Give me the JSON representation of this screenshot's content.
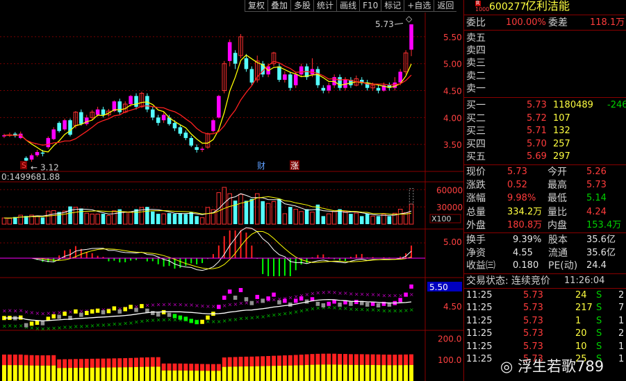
{
  "toolbar": [
    "复权",
    "叠加",
    "多股",
    "统计",
    "画线",
    "F10",
    "标记",
    "+自选",
    "返回"
  ],
  "stock": {
    "badge_top": "R",
    "badge_bottom": "1000",
    "code": "600277",
    "name": "亿利洁能"
  },
  "order_ratio": {
    "label": "委比",
    "value": "100.00%",
    "diff_label": "委差",
    "diff_value": "118.1万"
  },
  "sell_levels": [
    "卖五",
    "卖四",
    "卖三",
    "卖二",
    "卖一"
  ],
  "buy_levels": [
    {
      "label": "买一",
      "price": "5.73",
      "volume": "1180489",
      "change": "-246"
    },
    {
      "label": "买二",
      "price": "5.72",
      "volume": "107",
      "change": ""
    },
    {
      "label": "买三",
      "price": "5.71",
      "volume": "132",
      "change": ""
    },
    {
      "label": "买四",
      "price": "5.70",
      "volume": "257",
      "change": ""
    },
    {
      "label": "买五",
      "price": "5.69",
      "volume": "297",
      "change": ""
    }
  ],
  "quote": [
    {
      "l1": "现价",
      "v1": "5.73",
      "l2": "今开",
      "v2": "5.26"
    },
    {
      "l1": "涨跌",
      "v1": "0.52",
      "l2": "最高",
      "v2": "5.73"
    },
    {
      "l1": "涨幅",
      "v1": "9.98%",
      "l2": "最低",
      "v2": "5.14"
    },
    {
      "l1": "总量",
      "v1": "334.2万",
      "l2": "量比",
      "v2": "4.24"
    },
    {
      "l1": "外盘",
      "v1": "180.8万",
      "l2": "内盘",
      "v2": "153.4万"
    }
  ],
  "finance": [
    {
      "l1": "换手",
      "v1": "9.39%",
      "l2": "股本",
      "v2": "35.6亿"
    },
    {
      "l1": "净资",
      "v1": "4.55",
      "l2": "流通",
      "v2": "35.6亿"
    },
    {
      "l1": "收益㈢",
      "v1": "0.180",
      "l2": "PE(动)",
      "v2": "24.4"
    }
  ],
  "trade_status": {
    "label": "交易状态:",
    "value": "连续竞价",
    "time": "11:26:04"
  },
  "ticks": [
    {
      "time": "11:25",
      "price": "5.73",
      "vol": "24",
      "side": "S",
      "n": "2"
    },
    {
      "time": "11:25",
      "price": "5.73",
      "vol": "217",
      "side": "S",
      "n": "7"
    },
    {
      "time": "11:25",
      "price": "5.73",
      "vol": "1",
      "side": "S",
      "n": "1"
    },
    {
      "time": "11:25",
      "price": "5.73",
      "vol": "20",
      "side": "S",
      "n": "2"
    },
    {
      "time": "11:25",
      "price": "5.73",
      "vol": "10",
      "side": "S",
      "n": "1"
    },
    {
      "time": "11:25",
      "price": "5.73",
      "vol": "25",
      "side": "S",
      "n": "1"
    }
  ],
  "chart_data": {
    "type": "candlestick",
    "price_axis_ticks": [
      "5.50",
      "5.00",
      "4.50",
      "4.00",
      "3.50"
    ],
    "ylim": [
      3.0,
      5.95
    ],
    "annotations": {
      "high": "5.73",
      "low": "3.12",
      "marker_s": "S",
      "marker_cai": "财",
      "marker_zhang": "涨"
    },
    "volume_label": "0:1499681.88",
    "volume_ticks": [
      "60000",
      "30000"
    ],
    "volume_unit": "X100",
    "macd_tick": "5.00",
    "indicator_ticks": [
      "5.50",
      "4.50"
    ],
    "bottom_ticks": [
      "200.0",
      "100.0"
    ],
    "candles": [
      [
        3.65,
        3.67,
        3.7,
        3.62
      ],
      [
        3.67,
        3.68,
        3.72,
        3.64
      ],
      [
        3.7,
        3.66,
        3.73,
        3.63
      ],
      [
        3.62,
        3.7,
        3.74,
        3.6
      ],
      [
        3.25,
        3.2,
        3.28,
        3.12
      ],
      [
        3.22,
        3.3,
        3.33,
        3.18
      ],
      [
        3.3,
        3.36,
        3.4,
        3.27
      ],
      [
        3.35,
        3.33,
        3.4,
        3.28
      ],
      [
        3.45,
        3.62,
        3.65,
        3.42
      ],
      [
        3.6,
        3.78,
        3.82,
        3.58
      ],
      [
        3.9,
        3.75,
        3.93,
        3.72
      ],
      [
        3.78,
        3.95,
        3.98,
        3.75
      ],
      [
        3.95,
        3.68,
        3.98,
        3.65
      ],
      [
        3.85,
        4.1,
        4.12,
        3.8
      ],
      [
        4.1,
        3.88,
        4.15,
        3.85
      ],
      [
        3.88,
        4.0,
        4.05,
        3.85
      ],
      [
        4.0,
        4.1,
        4.14,
        3.96
      ],
      [
        4.05,
        4.15,
        4.2,
        4.02
      ],
      [
        4.15,
        4.05,
        4.2,
        4.0
      ],
      [
        4.05,
        4.12,
        4.16,
        4.02
      ],
      [
        4.12,
        4.3,
        4.32,
        4.1
      ],
      [
        4.3,
        4.1,
        4.35,
        4.06
      ],
      [
        4.1,
        4.25,
        4.3,
        4.08
      ],
      [
        4.25,
        4.4,
        4.42,
        4.2
      ],
      [
        4.4,
        4.2,
        4.45,
        4.15
      ],
      [
        4.2,
        4.45,
        4.48,
        4.18
      ],
      [
        4.4,
        4.15,
        4.45,
        4.1
      ],
      [
        4.15,
        4.0,
        4.2,
        3.95
      ],
      [
        4.0,
        3.9,
        4.05,
        3.85
      ],
      [
        3.95,
        4.05,
        4.1,
        3.9
      ],
      [
        4.0,
        3.88,
        4.05,
        3.85
      ],
      [
        3.9,
        3.8,
        3.95,
        3.75
      ],
      [
        3.82,
        3.7,
        3.86,
        3.66
      ],
      [
        3.72,
        3.62,
        3.76,
        3.58
      ],
      [
        3.62,
        3.48,
        3.66,
        3.45
      ],
      [
        3.45,
        3.4,
        3.5,
        3.35
      ],
      [
        3.4,
        3.42,
        3.46,
        3.36
      ],
      [
        3.45,
        3.7,
        3.72,
        3.42
      ],
      [
        3.75,
        3.95,
        3.98,
        3.72
      ],
      [
        4.0,
        4.4,
        4.42,
        3.98
      ],
      [
        4.5,
        5.0,
        5.05,
        4.45
      ],
      [
        5.05,
        5.4,
        5.45,
        4.95
      ],
      [
        5.2,
        5.0,
        5.25,
        4.9
      ],
      [
        5.15,
        5.5,
        5.55,
        5.1
      ],
      [
        5.1,
        4.9,
        5.18,
        4.85
      ],
      [
        4.9,
        4.65,
        4.95,
        4.6
      ],
      [
        4.7,
        5.05,
        5.15,
        4.65
      ],
      [
        5.0,
        4.8,
        5.05,
        4.75
      ],
      [
        4.8,
        4.95,
        5.0,
        4.75
      ],
      [
        5.0,
        5.2,
        5.22,
        4.95
      ],
      [
        4.95,
        4.7,
        5.0,
        4.66
      ],
      [
        4.7,
        4.8,
        4.86,
        4.65
      ],
      [
        4.8,
        4.55,
        4.85,
        4.5
      ],
      [
        4.6,
        4.8,
        4.85,
        4.55
      ],
      [
        4.8,
        4.95,
        5.0,
        4.75
      ],
      [
        4.95,
        4.75,
        5.0,
        4.7
      ],
      [
        4.8,
        4.9,
        5.1,
        4.75
      ],
      [
        4.9,
        4.6,
        4.95,
        4.55
      ],
      [
        4.55,
        4.5,
        4.6,
        4.45
      ],
      [
        4.5,
        4.6,
        4.65,
        4.45
      ],
      [
        4.6,
        4.75,
        4.8,
        4.55
      ],
      [
        4.75,
        4.55,
        4.8,
        4.5
      ],
      [
        4.55,
        4.7,
        4.75,
        4.5
      ],
      [
        4.7,
        4.6,
        4.75,
        4.55
      ],
      [
        4.6,
        4.72,
        4.78,
        4.58
      ],
      [
        4.7,
        4.65,
        4.75,
        4.6
      ],
      [
        4.65,
        4.55,
        4.7,
        4.5
      ],
      [
        4.55,
        4.6,
        4.65,
        4.5
      ],
      [
        4.55,
        4.5,
        4.6,
        4.45
      ],
      [
        4.5,
        4.6,
        4.65,
        4.48
      ],
      [
        4.6,
        4.55,
        4.65,
        4.5
      ],
      [
        4.55,
        4.65,
        4.75,
        4.5
      ],
      [
        4.65,
        4.85,
        4.9,
        4.6
      ],
      [
        4.85,
        5.2,
        5.25,
        4.8
      ],
      [
        5.26,
        5.73,
        5.73,
        5.14
      ]
    ]
  }
}
